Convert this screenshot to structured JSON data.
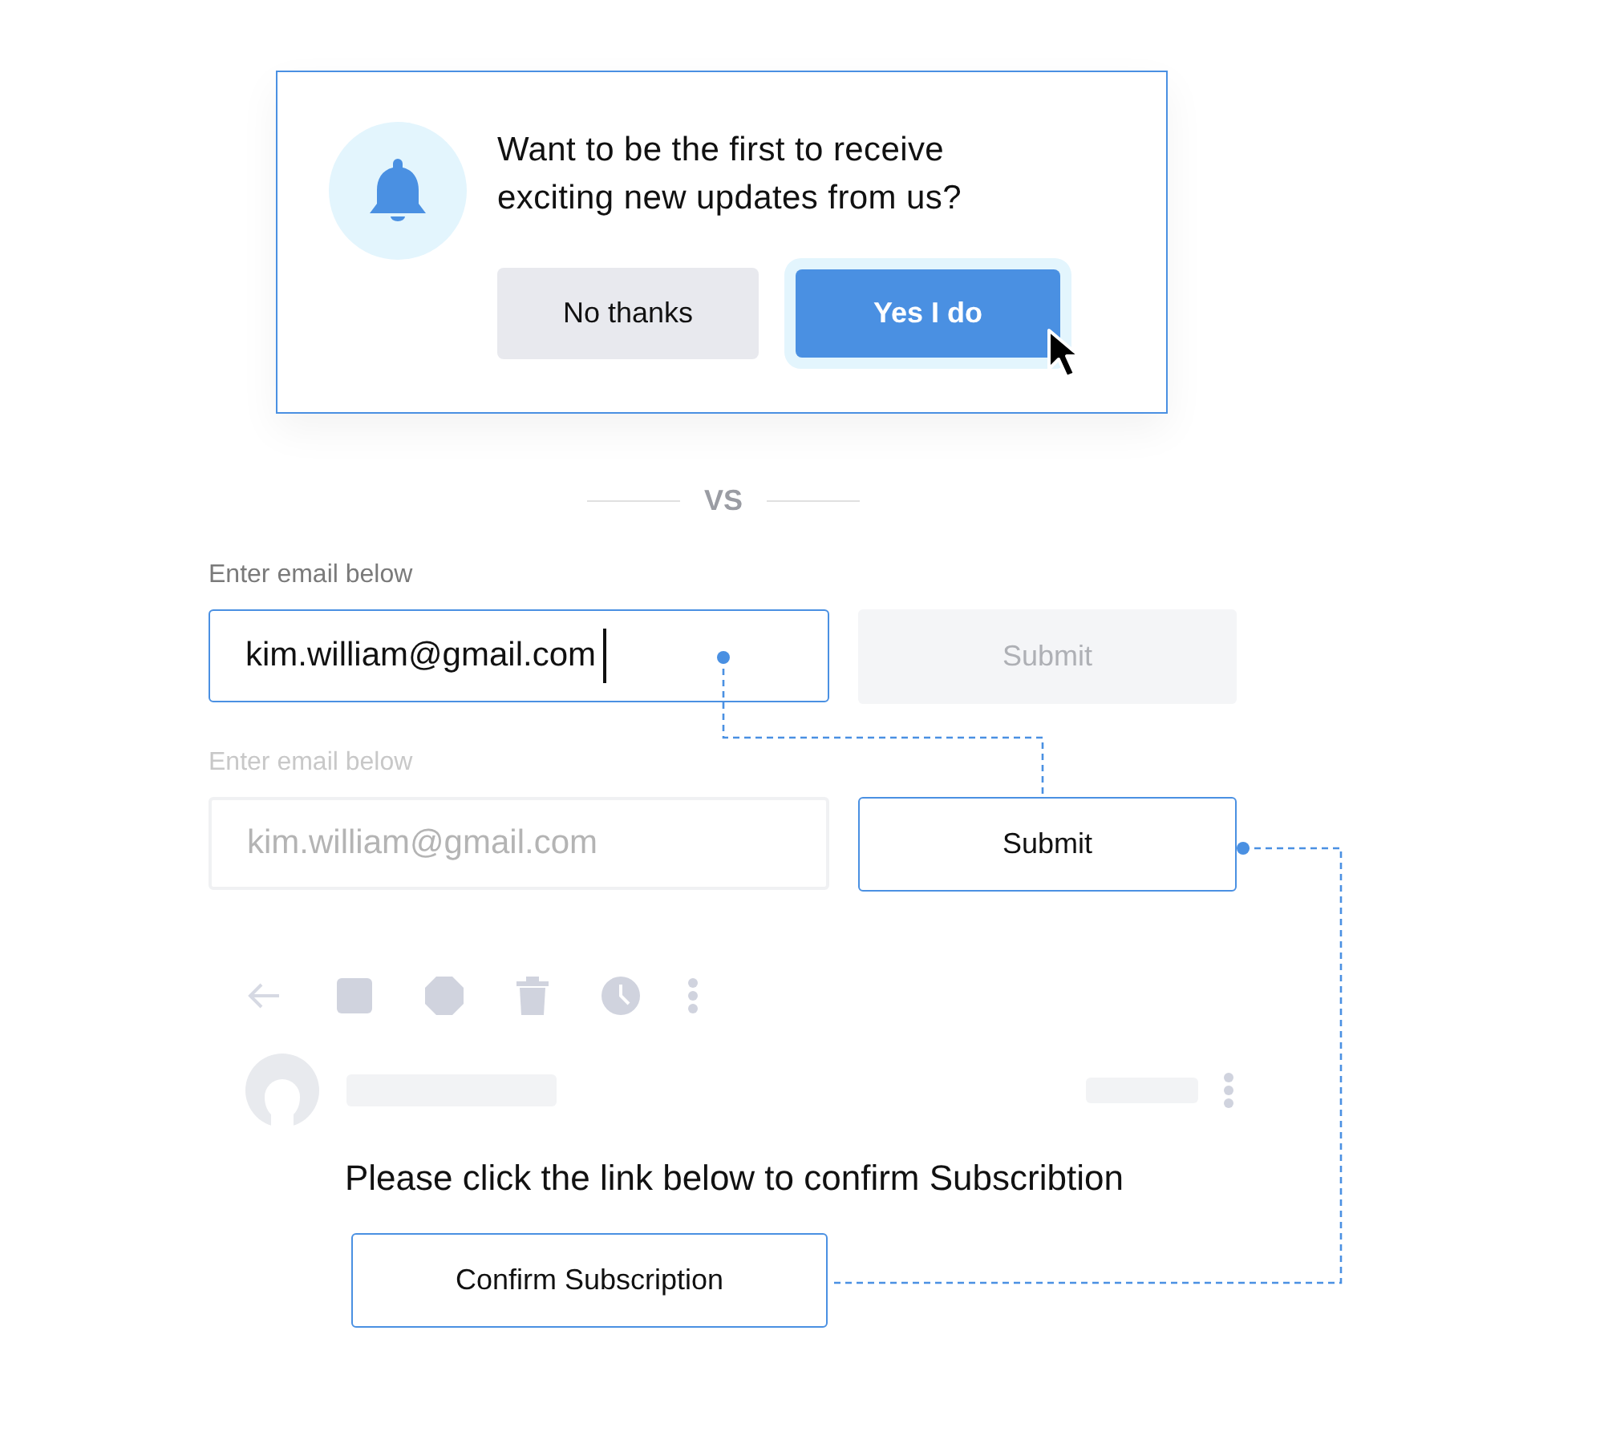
{
  "popup": {
    "message": "Want to be the first to receive exciting new updates from us?",
    "buttons": [
      {
        "label": "No thanks",
        "kind": "secondary",
        "hovered": false
      },
      {
        "label": "Yes I do",
        "kind": "primary",
        "hovered": true
      }
    ]
  },
  "divider": {
    "label": "VS"
  },
  "forms": [
    {
      "label": "Enter email below",
      "value": "kim.william@gmail.com",
      "focused": true,
      "faded": false,
      "submit": {
        "label": "Submit",
        "disabled": true
      }
    },
    {
      "label": "Enter email below",
      "value": "kim.william@gmail.com",
      "focused": false,
      "faded": true,
      "submit": {
        "label": "Submit",
        "disabled": false
      }
    }
  ],
  "email": {
    "message": "Please click the link below to confirm Subscribtion",
    "button": {
      "label": "Confirm Subscription"
    }
  }
}
